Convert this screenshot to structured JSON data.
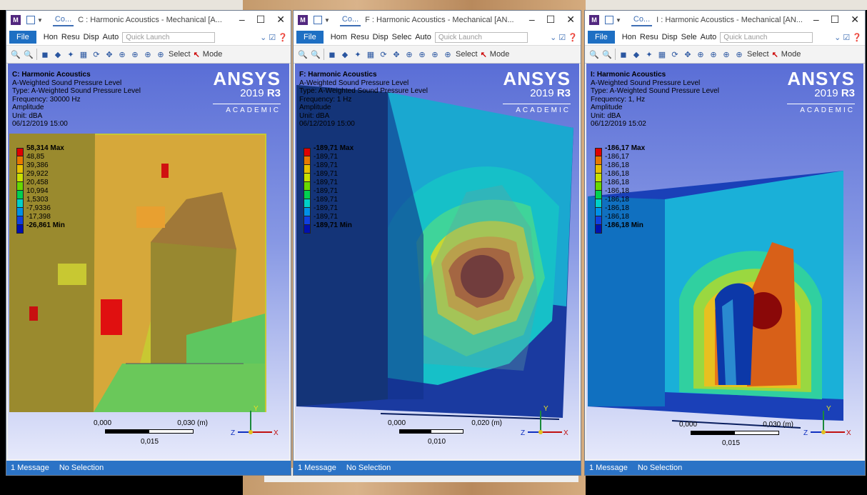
{
  "windows": [
    {
      "id": "c",
      "tab": "Co...",
      "title": "C : Harmonic Acoustics - Mechanical [A...",
      "ribbon": {
        "file": "File",
        "tabs": [
          "Hon",
          "Resu",
          "Disp",
          "Auto"
        ],
        "quick_launch_placeholder": "Quick Launch"
      },
      "toolbar": {
        "select": "Select",
        "mode": "Mode"
      },
      "info": {
        "title": "C: Harmonic Acoustics",
        "lines": [
          "A-Weighted Sound Pressure Level",
          "Type: A-Weighted Sound Pressure Level",
          "Frequency: 30000 Hz",
          "Amplitude",
          "Unit: dBA",
          "06/12/2019 15:00"
        ]
      },
      "logo": {
        "brand": "ANSYS",
        "year": "2019",
        "release": "R3",
        "edition": "ACADEMIC"
      },
      "legend": {
        "values": [
          "58,314 Max",
          "48,85",
          "39,386",
          "29,922",
          "20,458",
          "10,994",
          "1,5303",
          "-7,9336",
          "-17,398",
          "-26,861 Min"
        ],
        "colors": [
          "#e00000",
          "#e87800",
          "#e8c000",
          "#c8e000",
          "#68d800",
          "#00d050",
          "#00d0c8",
          "#0090e8",
          "#1040e0",
          "#0010b0"
        ]
      },
      "scale": {
        "left": "0,000",
        "right": "0,030 (m)",
        "mid": "0,015"
      },
      "status": {
        "messages": "1 Message",
        "selection": "No Selection"
      },
      "axes": {
        "y": "Y",
        "z": "Z",
        "x": "X"
      }
    },
    {
      "id": "f",
      "tab": "Co...",
      "title": "F : Harmonic Acoustics - Mechanical [AN...",
      "ribbon": {
        "file": "File",
        "tabs": [
          "Hom",
          "Resu",
          "Disp",
          "Selec",
          "Auto"
        ],
        "quick_launch_placeholder": "Quick Launch"
      },
      "toolbar": {
        "select": "Select",
        "mode": "Mode"
      },
      "info": {
        "title": "F: Harmonic Acoustics",
        "lines": [
          "A-Weighted Sound Pressure Level",
          "Type: A-Weighted Sound Pressure Level",
          "Frequency: 1 Hz",
          "Amplitude",
          "Unit: dBA",
          "06/12/2019 15:00"
        ]
      },
      "logo": {
        "brand": "ANSYS",
        "year": "2019",
        "release": "R3",
        "edition": "ACADEMIC"
      },
      "legend": {
        "values": [
          "-189,71 Max",
          "-189,71",
          "-189,71",
          "-189,71",
          "-189,71",
          "-189,71",
          "-189,71",
          "-189,71",
          "-189,71",
          "-189,71 Min"
        ],
        "colors": [
          "#e00000",
          "#e87800",
          "#e8c000",
          "#c8e000",
          "#68d800",
          "#00d050",
          "#00d0c8",
          "#0090e8",
          "#1040e0",
          "#0010b0"
        ]
      },
      "scale": {
        "left": "0,000",
        "right": "0,020 (m)",
        "mid": "0,010"
      },
      "status": {
        "messages": "1 Message",
        "selection": "No Selection"
      },
      "axes": {
        "y": "Y",
        "z": "Z",
        "x": "X"
      }
    },
    {
      "id": "i",
      "tab": "Co...",
      "title": "I : Harmonic Acoustics - Mechanical [AN...",
      "ribbon": {
        "file": "File",
        "tabs": [
          "Hon",
          "Resu",
          "Disp",
          "Sele",
          "Auto"
        ],
        "quick_launch_placeholder": "Quick Launch"
      },
      "toolbar": {
        "select": "Select",
        "mode": "Mode"
      },
      "info": {
        "title": "I: Harmonic Acoustics",
        "lines": [
          "A-Weighted Sound Pressure Level",
          "Type: A-Weighted Sound Pressure Level",
          "Frequency: 1, Hz",
          "Amplitude",
          "Unit: dBA",
          "06/12/2019 15:02"
        ]
      },
      "logo": {
        "brand": "ANSYS",
        "year": "2019",
        "release": "R3",
        "edition": "ACADEMIC"
      },
      "legend": {
        "values": [
          "-186,17 Max",
          "-186,17",
          "-186,18",
          "-186,18",
          "-186,18",
          "-186,18",
          "-186,18",
          "-186,18",
          "-186,18",
          "-186,18 Min"
        ],
        "colors": [
          "#e00000",
          "#e87800",
          "#e8c000",
          "#c8e000",
          "#68d800",
          "#00d050",
          "#00d0c8",
          "#0090e8",
          "#1040e0",
          "#0010b0"
        ]
      },
      "scale": {
        "left": "0,000",
        "right": "0,030 (m)",
        "mid": "0,015"
      },
      "status": {
        "messages": "1 Message",
        "selection": "No Selection"
      },
      "axes": {
        "y": "Y",
        "z": "Z",
        "x": "X"
      }
    }
  ]
}
